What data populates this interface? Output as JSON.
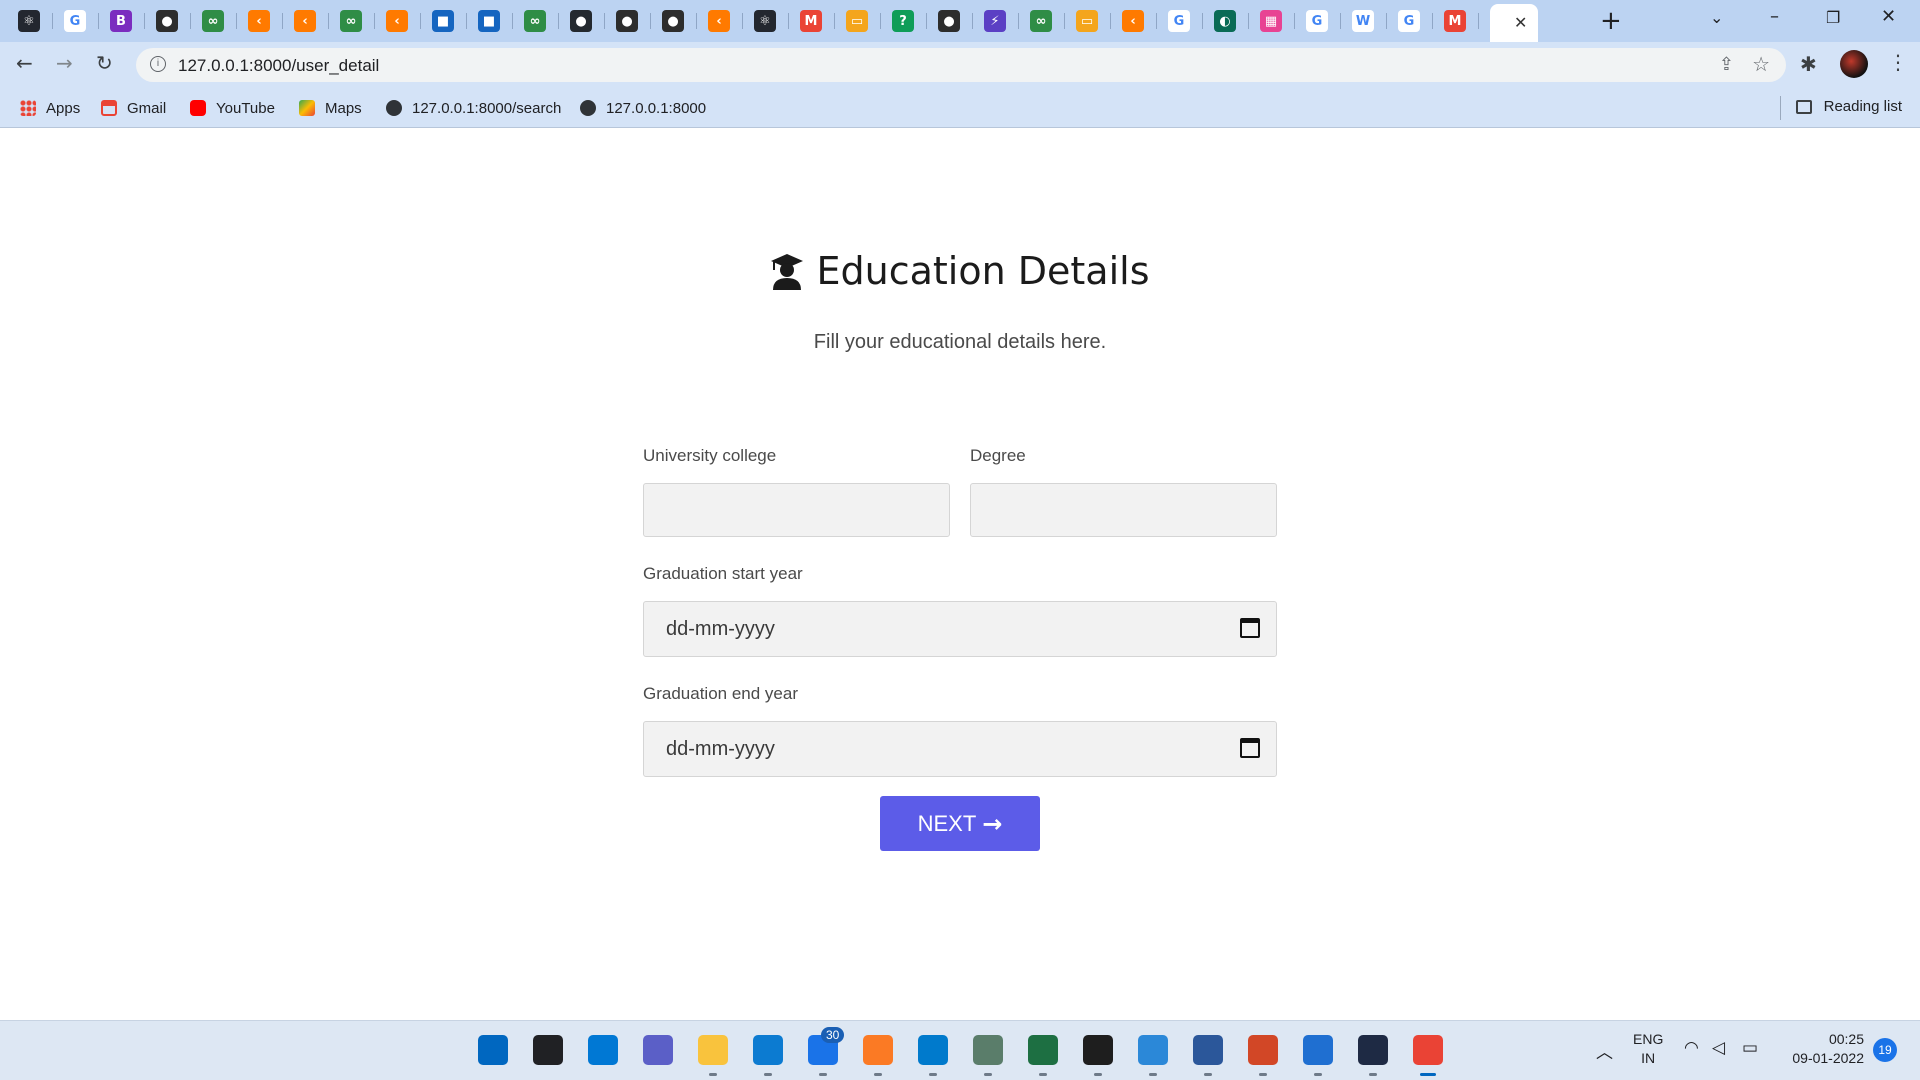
{
  "browser": {
    "url": "127.0.0.1:8000/user_detail",
    "new_tab": "+",
    "bookmarks": [
      "Apps",
      "Gmail",
      "YouTube",
      "Maps",
      "127.0.0.1:8000/search",
      "127.0.0.1:8000"
    ],
    "reading_list": "Reading list",
    "tab_icons": [
      "react-icon",
      "google-icon",
      "bootstrap-icon",
      "globe-icon",
      "infinity-icon",
      "code-icon",
      "code-icon",
      "infinity-icon",
      "code-icon",
      "box-icon",
      "box-icon",
      "infinity-icon",
      "github-icon",
      "globe-icon",
      "globe-icon",
      "code-icon",
      "react-icon",
      "gmail-icon",
      "code-icon",
      "question-icon",
      "globe-icon",
      "bolt-icon",
      "infinity-icon",
      "code-icon",
      "code-icon",
      "google-icon",
      "leaf-icon",
      "grid-icon",
      "google-icon",
      "wikipedia-icon",
      "google-icon",
      "gmail-icon"
    ],
    "tab_colors": [
      "#23272f",
      "#ffffff",
      "#7b2cbf",
      "#2d2d2d",
      "#2f8d46",
      "#ff7a00",
      "#ff7a00",
      "#2f8d46",
      "#ff7a00",
      "#1565c0",
      "#1565c0",
      "#2f8d46",
      "#24292f",
      "#2d2d2d",
      "#2d2d2d",
      "#ff7a00",
      "#23272f",
      "#ea4335",
      "#f4a51c",
      "#0f9d58",
      "#2d2d2d",
      "#5b3fc4",
      "#2f8d46",
      "#f4a51c",
      "#ff7a00",
      "#ffffff",
      "#0a6b55",
      "#e84393",
      "#ffffff",
      "#ffffff",
      "#ffffff",
      "#ea4335"
    ],
    "tab_letters": [
      "⚛",
      "G",
      "B",
      "●",
      "∞",
      "‹",
      "‹",
      "∞",
      "‹",
      "■",
      "■",
      "∞",
      "●",
      "●",
      "●",
      "‹",
      "⚛",
      "M",
      "▭",
      "?",
      "●",
      "⚡",
      "∞",
      "▭",
      "‹",
      "G",
      "◐",
      "▦",
      "G",
      "W",
      "G",
      "M"
    ]
  },
  "page": {
    "title": "Education Details",
    "subtitle": "Fill your educational details here.",
    "fields": {
      "university_label": "University college",
      "degree_label": "Degree",
      "start_label": "Graduation start year",
      "start_placeholder": "dd-mm-yyyy",
      "end_label": "Graduation end year",
      "end_placeholder": "dd-mm-yyyy"
    },
    "next_button": "NEXT"
  },
  "taskbar": {
    "apps": [
      "windows-start-icon",
      "search-icon",
      "widgets-icon",
      "teams-chat-icon",
      "file-explorer-icon",
      "edge-icon",
      "mail-icon",
      "xampp-icon",
      "vscode-icon",
      "app-icon",
      "excel-icon",
      "terminal-icon",
      "notepad-icon",
      "word-icon",
      "powerpoint-icon",
      "help-icon",
      "dev-icon",
      "chrome-icon"
    ],
    "app_colors": [
      "#0067c0",
      "#202124",
      "#0078d4",
      "#5b5fc7",
      "#f9c33d",
      "#0c7bd1",
      "#1a73e8",
      "#fb7a24",
      "#007acc",
      "#5a7d6a",
      "#1d6f42",
      "#1e1e1e",
      "#2b88d8",
      "#2b579a",
      "#d24726",
      "#1f6fd1",
      "#1e2a44",
      "#ea4335"
    ],
    "mail_badge": "30",
    "lang_top": "ENG",
    "lang_bottom": "IN",
    "time": "00:25",
    "date": "09-01-2022",
    "notifications": "19"
  }
}
